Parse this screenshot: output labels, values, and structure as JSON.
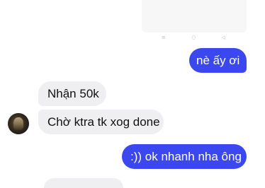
{
  "messages": [
    {
      "text": "nè ấy ơi",
      "direction": "outgoing"
    },
    {
      "text": "Nhận 50k",
      "direction": "incoming"
    },
    {
      "text": "Chờ ktra tk xog done",
      "direction": "incoming"
    },
    {
      "text": ":)) ok nhanh nha ông",
      "direction": "outgoing"
    }
  ],
  "image_nav_icons": [
    "menu-icon",
    "home-icon",
    "back-icon"
  ],
  "colors": {
    "outgoing_bubble": "#3b48ef",
    "incoming_bubble": "#efeff1",
    "background": "#ffffff"
  }
}
